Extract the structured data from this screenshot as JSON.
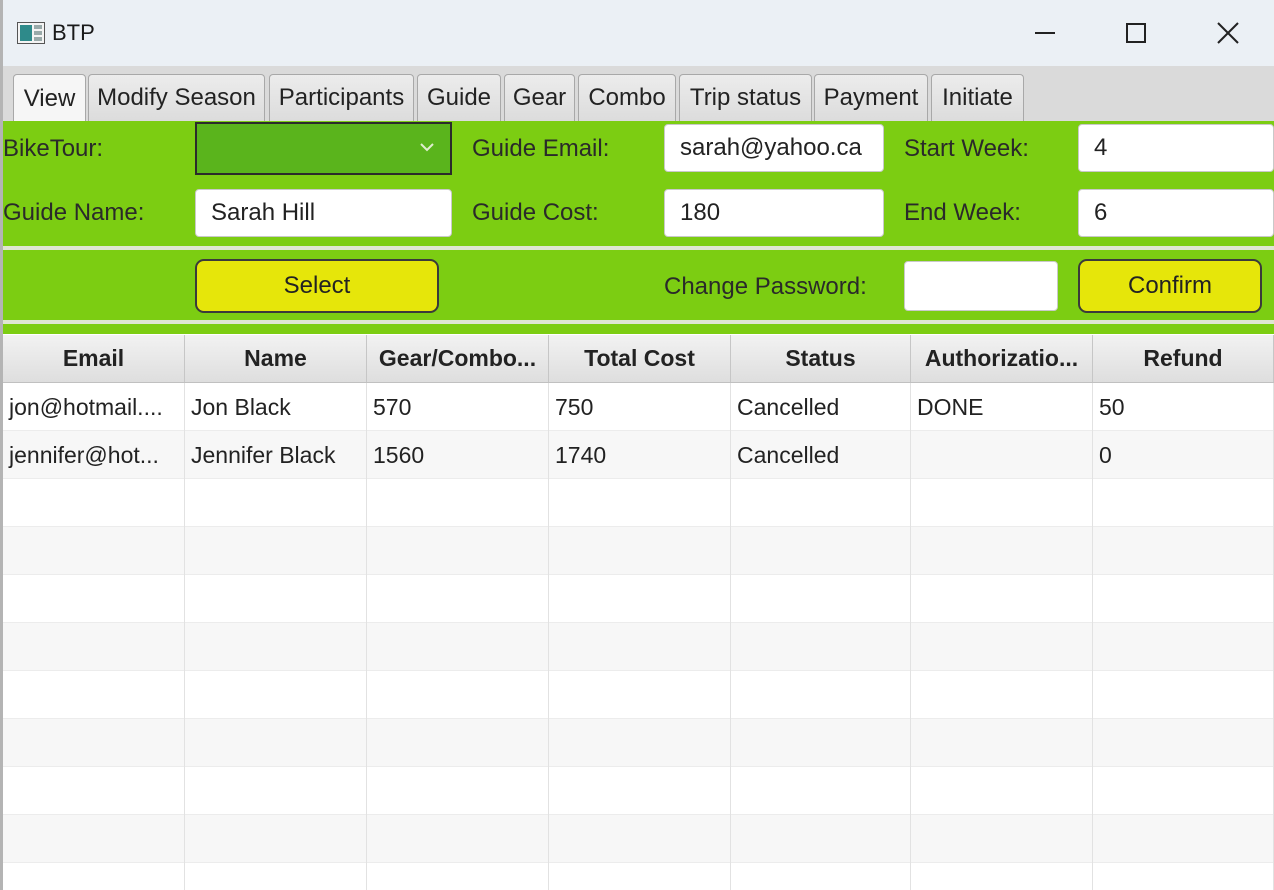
{
  "window": {
    "title": "BTP"
  },
  "tabs": [
    {
      "label": "View"
    },
    {
      "label": "Modify Season"
    },
    {
      "label": "Participants"
    },
    {
      "label": "Guide"
    },
    {
      "label": "Gear"
    },
    {
      "label": "Combo"
    },
    {
      "label": "Trip status"
    },
    {
      "label": "Payment"
    },
    {
      "label": "Initiate"
    }
  ],
  "form": {
    "biketour_label": "BikeTour:",
    "biketour_value": "",
    "guide_name_label": "Guide Name:",
    "guide_name_value": "Sarah Hill",
    "guide_email_label": "Guide Email:",
    "guide_email_value": "sarah@yahoo.ca",
    "guide_cost_label": "Guide Cost:",
    "guide_cost_value": "180",
    "start_week_label": "Start Week:",
    "start_week_value": "4",
    "end_week_label": "End Week:",
    "end_week_value": "6"
  },
  "actions": {
    "select_label": "Select",
    "change_password_label": "Change Password:",
    "change_password_value": "",
    "confirm_label": "Confirm"
  },
  "table": {
    "columns": [
      "Email",
      "Name",
      "Gear/Combo...",
      "Total Cost",
      "Status",
      "Authorizatio...",
      "Refund"
    ],
    "rows": [
      [
        "jon@hotmail....",
        "Jon Black",
        "570",
        "750",
        "Cancelled",
        "DONE",
        "50"
      ],
      [
        "jennifer@hot...",
        "Jennifer Black",
        "1560",
        "1740",
        "Cancelled",
        "",
        "0"
      ]
    ]
  },
  "colors": {
    "panel_green": "#7ccd12",
    "combo_green": "#5ab41c",
    "button_yellow": "#e6e60a"
  }
}
